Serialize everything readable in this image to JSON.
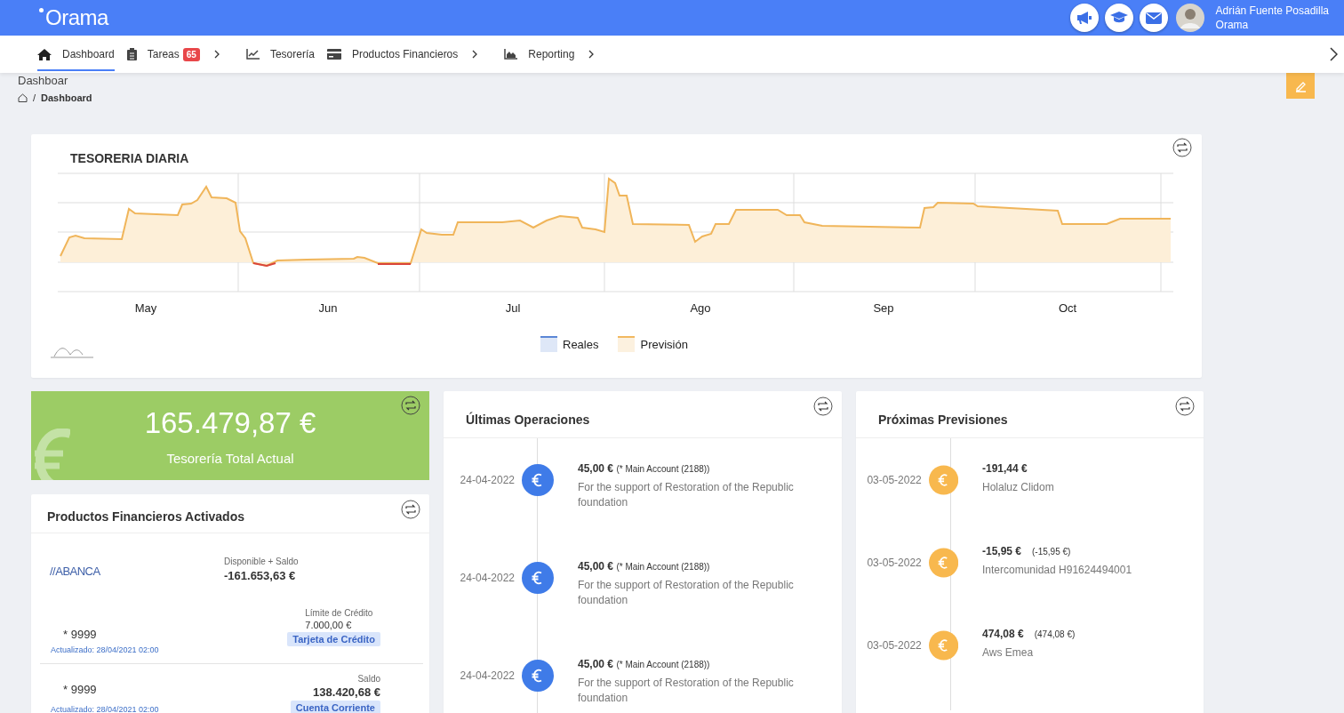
{
  "header": {
    "logo": "Orama",
    "user": {
      "name": "Adrián Fuente Posadilla",
      "org": "Orama"
    }
  },
  "nav": [
    {
      "label": "Dashboard",
      "selected": true,
      "has_submenu": false
    },
    {
      "label": "Tareas",
      "badge": "65",
      "selected": false,
      "has_submenu": true
    },
    {
      "label": "Tesorería",
      "selected": false,
      "has_submenu": false
    },
    {
      "label": "Productos Financieros",
      "selected": false,
      "has_submenu": true
    },
    {
      "label": "Reporting",
      "selected": false,
      "has_submenu": true
    }
  ],
  "page": {
    "title": "Dashboar",
    "separator": "/",
    "breadcrumb": "Dashboard"
  },
  "chart_card": {
    "title": "TESORERIA DIARIA",
    "months": [
      "May",
      "Jun",
      "Jul",
      "Ago",
      "Sep",
      "Oct"
    ],
    "legend": [
      {
        "label": "Reales",
        "color": "#5b87d6"
      },
      {
        "label": "Previsión",
        "color": "#f2b860"
      }
    ]
  },
  "total": {
    "amount": "165.479,87 €",
    "label": "Tesorería Total Actual"
  },
  "products": {
    "title": "Productos Financieros Activados",
    "bank": "//ABANCA",
    "summary_label": "Disponible + Saldo",
    "summary_value": "-161.653,63 €",
    "accounts": [
      {
        "number": "* 9999",
        "updated": "Actualizado: 28/04/2021 02:00",
        "value_label": "Límite de Crédito",
        "value": "7.000,00 €",
        "tag": "Tarjeta de Crédito",
        "kind": "credit"
      },
      {
        "number": "* 9999",
        "updated": "Actualizado: 28/04/2021 02:00",
        "value_label": "Saldo",
        "value": "138.420,68 €",
        "tag": "Cuenta Corriente",
        "kind": "current"
      }
    ]
  },
  "operations": {
    "title": "Últimas Operaciones",
    "items": [
      {
        "date": "24-04-2022",
        "amount": "45,00 €",
        "account": "(* Main Account (2188))",
        "description": "For the support of Restoration of the Republic foundation"
      },
      {
        "date": "24-04-2022",
        "amount": "45,00 €",
        "account": "(* Main Account (2188))",
        "description": "For the support of Restoration of the Republic foundation"
      },
      {
        "date": "24-04-2022",
        "amount": "45,00 €",
        "account": "(* Main Account (2188))",
        "description": "For the support of Restoration of the Republic foundation"
      }
    ]
  },
  "forecasts": {
    "title": "Próximas Previsiones",
    "items": [
      {
        "date": "03-05-2022",
        "amount": "-191,44 €",
        "description": "Holaluz Clidom"
      },
      {
        "date": "03-05-2022",
        "amount": "-15,95 €",
        "original": "(-15,95 €)",
        "description": "Intercomunidad H91624494001"
      },
      {
        "date": "03-05-2022",
        "amount": "474,08 €",
        "original": "(474,08 €)",
        "description": "Aws Emea"
      }
    ]
  }
}
